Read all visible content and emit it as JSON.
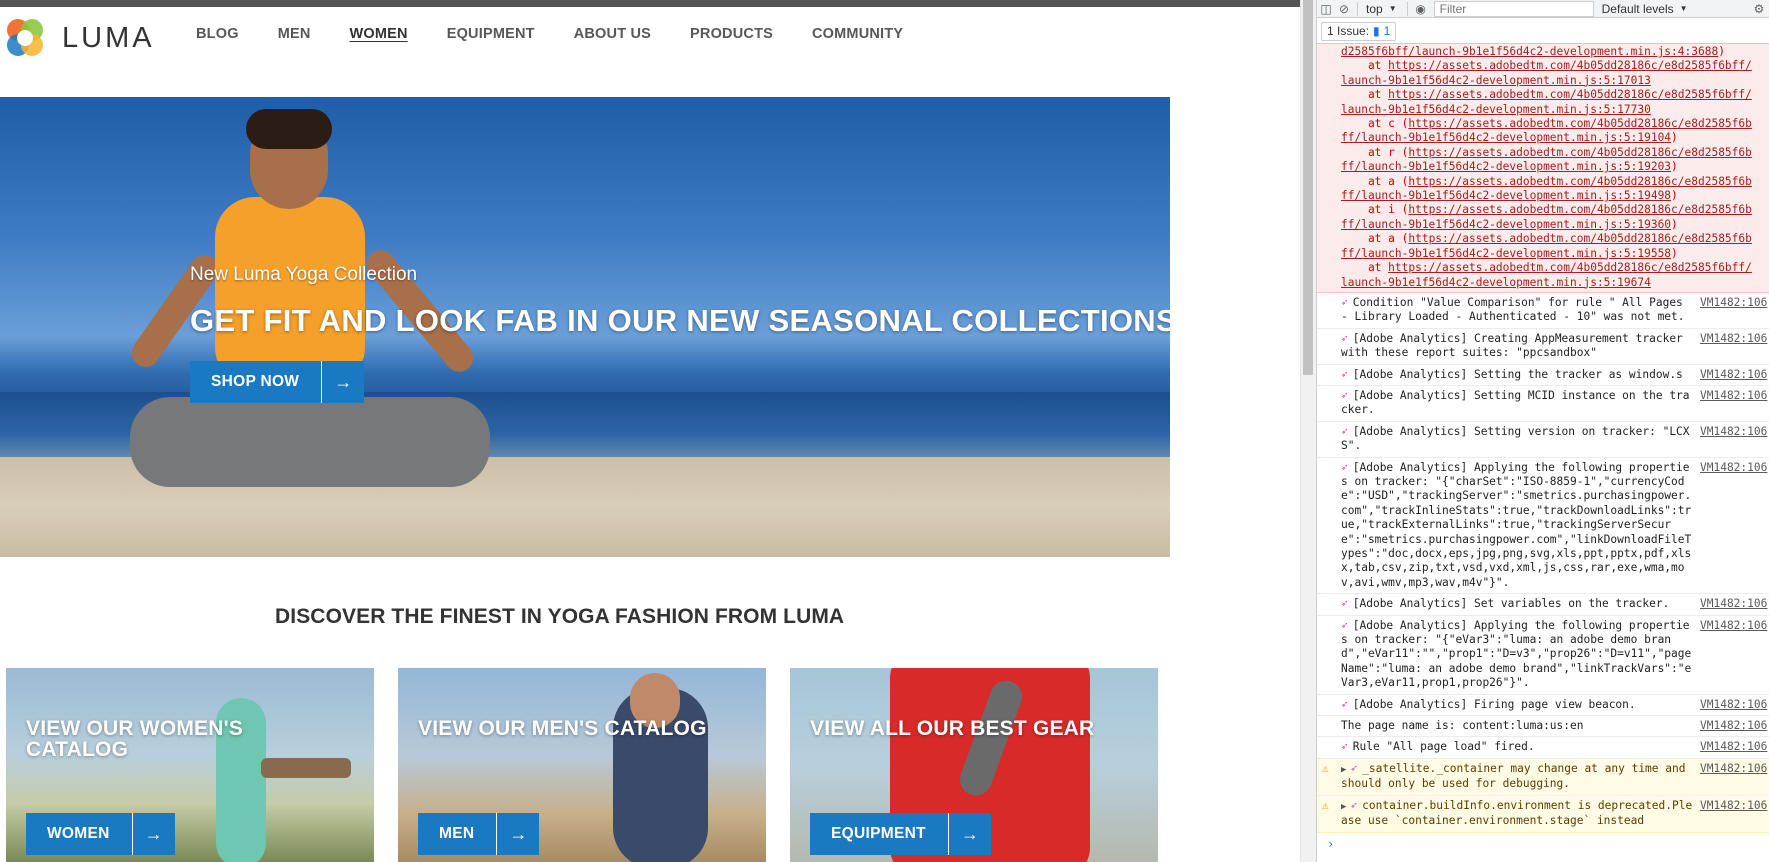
{
  "site": {
    "logo_text": "LUMA",
    "nav": [
      {
        "label": "BLOG",
        "active": false
      },
      {
        "label": "MEN",
        "active": false
      },
      {
        "label": "WOMEN",
        "active": true
      },
      {
        "label": "EQUIPMENT",
        "active": false
      },
      {
        "label": "ABOUT US",
        "active": false
      },
      {
        "label": "PRODUCTS",
        "active": false
      },
      {
        "label": "COMMUNITY",
        "active": false
      }
    ],
    "hero": {
      "subtitle": "New Luma Yoga Collection",
      "title": "GET FIT AND LOOK FAB IN OUR NEW SEASONAL COLLECTIONS",
      "cta_label": "SHOP NOW"
    },
    "discover_heading": "DISCOVER THE FINEST IN YOGA FASHION FROM LUMA",
    "tiles": [
      {
        "title": "VIEW OUR WOMEN'S CATALOG",
        "cta_label": "WOMEN"
      },
      {
        "title": "VIEW OUR MEN'S CATALOG",
        "cta_label": "MEN"
      },
      {
        "title": "VIEW ALL OUR BEST GEAR",
        "cta_label": "EQUIPMENT"
      }
    ],
    "brand_color": "#1979c3"
  },
  "devtools": {
    "context": "top",
    "filter_placeholder": "Filter",
    "levels": "Default levels",
    "issues_label": "1 Issue:",
    "issues_count": "1",
    "error_trace": [
      {
        "prefix": "",
        "link": "d2585f6bff/launch-9b1e1f56d4c2-development.min.js:4:3688",
        "suffix": ")"
      },
      {
        "prefix": "    at ",
        "link": "https://assets.adobedtm.com/4b05dd28186c/e8d2585f6bff/",
        "suffix": ""
      },
      {
        "prefix": "",
        "link": "launch-9b1e1f56d4c2-development.min.js:5:17013",
        "suffix": ""
      },
      {
        "prefix": "    at ",
        "link": "https://assets.adobedtm.com/4b05dd28186c/e8d2585f6bff/",
        "suffix": ""
      },
      {
        "prefix": "",
        "link": "launch-9b1e1f56d4c2-development.min.js:5:17730",
        "suffix": ""
      },
      {
        "prefix": "    at c (",
        "link": "https://assets.adobedtm.com/4b05dd28186c/e8d2585f6b",
        "suffix": ""
      },
      {
        "prefix": "",
        "link": "ff/launch-9b1e1f56d4c2-development.min.js:5:19104",
        "suffix": ")"
      },
      {
        "prefix": "    at r (",
        "link": "https://assets.adobedtm.com/4b05dd28186c/e8d2585f6b",
        "suffix": ""
      },
      {
        "prefix": "",
        "link": "ff/launch-9b1e1f56d4c2-development.min.js:5:19203",
        "suffix": ")"
      },
      {
        "prefix": "    at a (",
        "link": "https://assets.adobedtm.com/4b05dd28186c/e8d2585f6b",
        "suffix": ""
      },
      {
        "prefix": "",
        "link": "ff/launch-9b1e1f56d4c2-development.min.js:5:19498",
        "suffix": ")"
      },
      {
        "prefix": "    at i (",
        "link": "https://assets.adobedtm.com/4b05dd28186c/e8d2585f6b",
        "suffix": ""
      },
      {
        "prefix": "",
        "link": "ff/launch-9b1e1f56d4c2-development.min.js:5:19360",
        "suffix": ")"
      },
      {
        "prefix": "    at a (",
        "link": "https://assets.adobedtm.com/4b05dd28186c/e8d2585f6b",
        "suffix": ""
      },
      {
        "prefix": "",
        "link": "ff/launch-9b1e1f56d4c2-development.min.js:5:19558",
        "suffix": ")"
      },
      {
        "prefix": "    at ",
        "link": "https://assets.adobedtm.com/4b05dd28186c/e8d2585f6bff/",
        "suffix": ""
      },
      {
        "prefix": "",
        "link": "launch-9b1e1f56d4c2-development.min.js:5:19674",
        "suffix": ""
      }
    ],
    "messages": [
      {
        "level": "info",
        "rocket": true,
        "text": "Condition \"Value Comparison\" for rule \" All Pages - Library Loaded - Authenticated - 10\" was not met.",
        "source": "VM1482:106"
      },
      {
        "level": "info",
        "rocket": true,
        "text": "[Adobe Analytics] Creating AppMeasurement tracker with these report suites: \"ppcsandbox\"",
        "source": "VM1482:106"
      },
      {
        "level": "info",
        "rocket": true,
        "text": "[Adobe Analytics] Setting the tracker as window.s",
        "source": "VM1482:106"
      },
      {
        "level": "info",
        "rocket": true,
        "text": "[Adobe Analytics] Setting MCID instance on the tracker.",
        "source": "VM1482:106"
      },
      {
        "level": "info",
        "rocket": true,
        "text": "[Adobe Analytics] Setting version on tracker: \"LCXS\".",
        "source": "VM1482:106"
      },
      {
        "level": "info",
        "rocket": true,
        "text": "[Adobe Analytics] Applying the following properties on tracker: \"{\"charSet\":\"ISO-8859-1\",\"currencyCode\":\"USD\",\"trackingServer\":\"smetrics.purchasingpower.com\",\"trackInlineStats\":true,\"trackDownloadLinks\":true,\"trackExternalLinks\":true,\"trackingServerSecure\":\"smetrics.purchasingpower.com\",\"linkDownloadFileTypes\":\"doc,docx,eps,jpg,png,svg,xls,ppt,pptx,pdf,xlsx,tab,csv,zip,txt,vsd,vxd,xml,js,css,rar,exe,wma,mov,avi,wmv,mp3,wav,m4v\"}\".",
        "source": "VM1482:106"
      },
      {
        "level": "info",
        "rocket": true,
        "text": "[Adobe Analytics] Set variables on the tracker.",
        "source": "VM1482:106"
      },
      {
        "level": "info",
        "rocket": true,
        "text": "[Adobe Analytics] Applying the following properties on tracker: \"{\"eVar3\":\"luma: an adobe demo brand\",\"eVar11\":\"\",\"prop1\":\"D=v3\",\"prop26\":\"D=v11\",\"pageName\":\"luma: an adobe demo brand\",\"linkTrackVars\":\"eVar3,eVar11,prop1,prop26\"}\".",
        "source": "VM1482:106"
      },
      {
        "level": "info",
        "rocket": true,
        "text": "[Adobe Analytics] Firing page view beacon.",
        "source": "VM1482:106"
      },
      {
        "level": "info",
        "rocket": false,
        "text": "The page name is: content:luma:us:en",
        "source": "VM1482:106"
      },
      {
        "level": "info",
        "rocket": true,
        "text": "Rule \"All page load\" fired.",
        "source": "VM1482:106"
      },
      {
        "level": "warn",
        "rocket": true,
        "text": "_satellite._container may change at any time and should only be used for debugging.",
        "source": "VM1482:106"
      },
      {
        "level": "warn",
        "rocket": true,
        "text": "container.buildInfo.environment is deprecated.Please use `container.environment.stage` instead",
        "source": "VM1482:106"
      }
    ],
    "prompt_symbol": "›"
  }
}
